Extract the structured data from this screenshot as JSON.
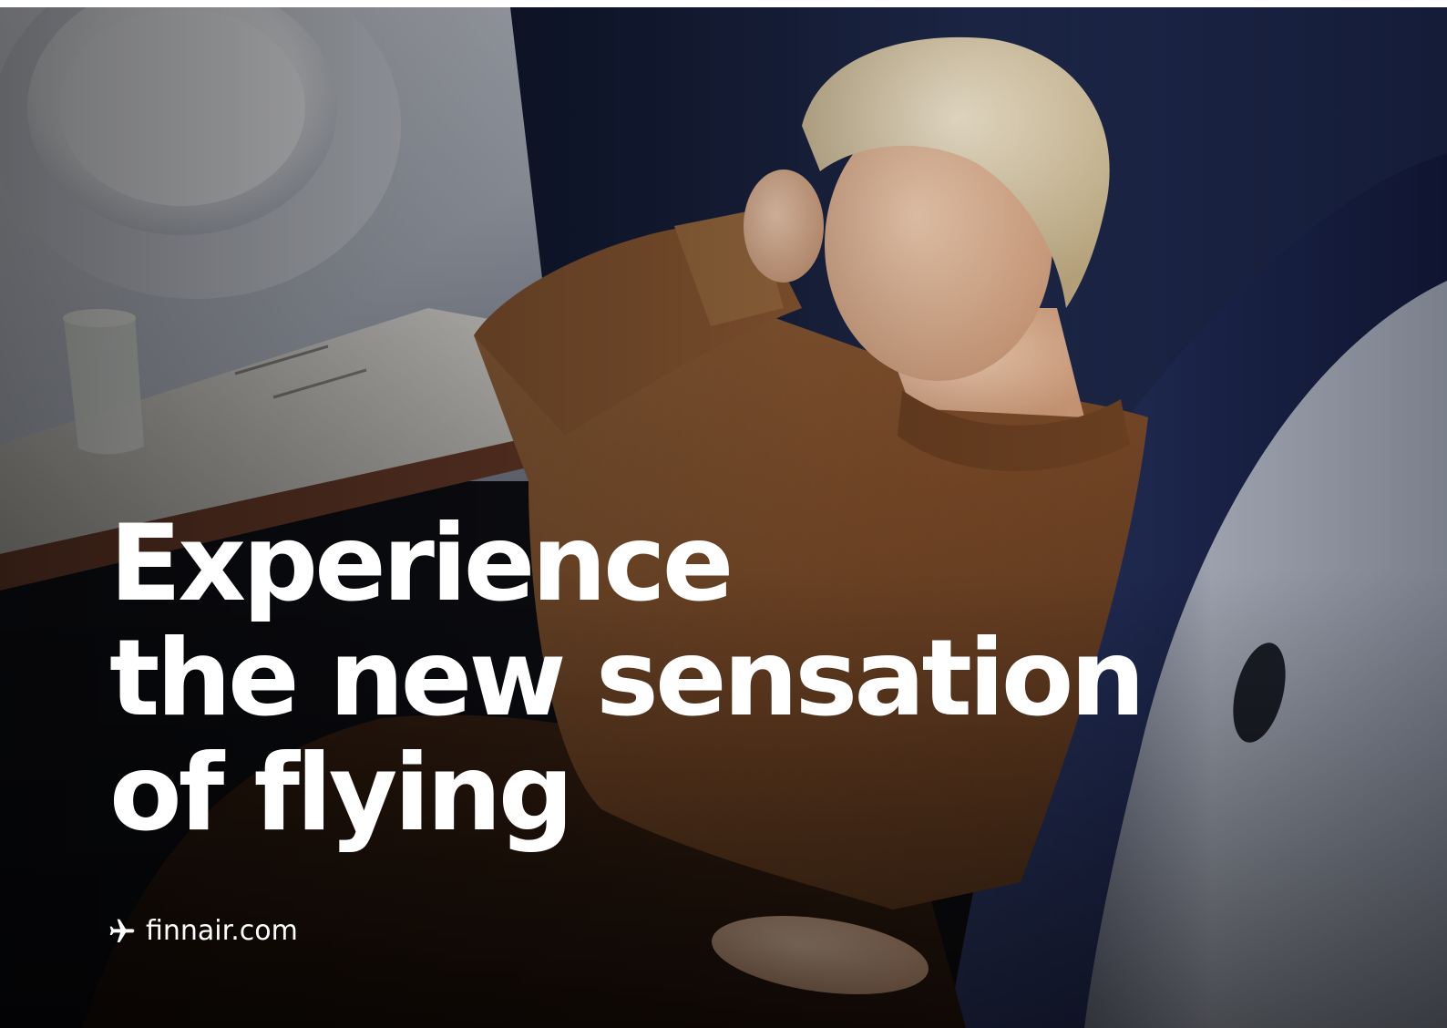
{
  "ad": {
    "headline": {
      "line1": "Experience",
      "line2": "the new sensation",
      "line3": "of flying"
    },
    "link": {
      "icon": "airplane-icon",
      "text": "finnair.com"
    }
  },
  "colors": {
    "text": "#ffffff",
    "seat_navy": "#1b2546",
    "sweater_brown": "#7a4a28",
    "hair_blonde": "#d9c8a2",
    "cabin_wall": "#c7ccd8"
  }
}
